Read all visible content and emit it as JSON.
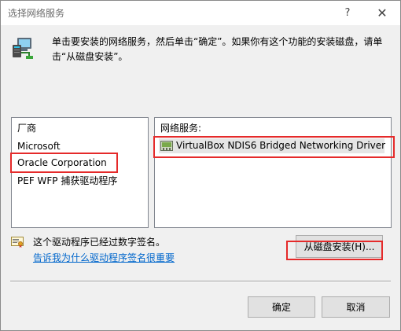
{
  "window": {
    "title": "选择网络服务",
    "help_glyph": "?",
    "close_glyph": "✕"
  },
  "instruction": "单击要安装的网络服务，然后单击“确定”。如果你有这个功能的安装磁盘，请单击“从磁盘安装”。",
  "manufacturer_list": {
    "header": "厂商",
    "items": [
      "Microsoft",
      "Oracle Corporation",
      "PEF WFP 捕获驱动程序"
    ],
    "selected": "Oracle Corporation"
  },
  "service_list": {
    "header": "网络服务:",
    "items": [
      "VirtualBox NDIS6 Bridged Networking Driver"
    ],
    "selected": "VirtualBox NDIS6 Bridged Networking Driver"
  },
  "signature": {
    "status": "这个驱动程序已经过数字签名。",
    "link": "告诉我为什么驱动程序签名很重要"
  },
  "buttons": {
    "have_disk": "从磁盘安装(H)...",
    "ok": "确定",
    "cancel": "取消"
  },
  "colors": {
    "highlight_box": "#e52a2a",
    "link": "#0066cc",
    "dialog_bg": "#f0f0f0",
    "selected_row": "#e5e5e5"
  },
  "icons": {
    "header_icon": "network-adapter-icon",
    "driver_icon": "network-driver-icon",
    "signature_icon": "certificate-icon"
  }
}
